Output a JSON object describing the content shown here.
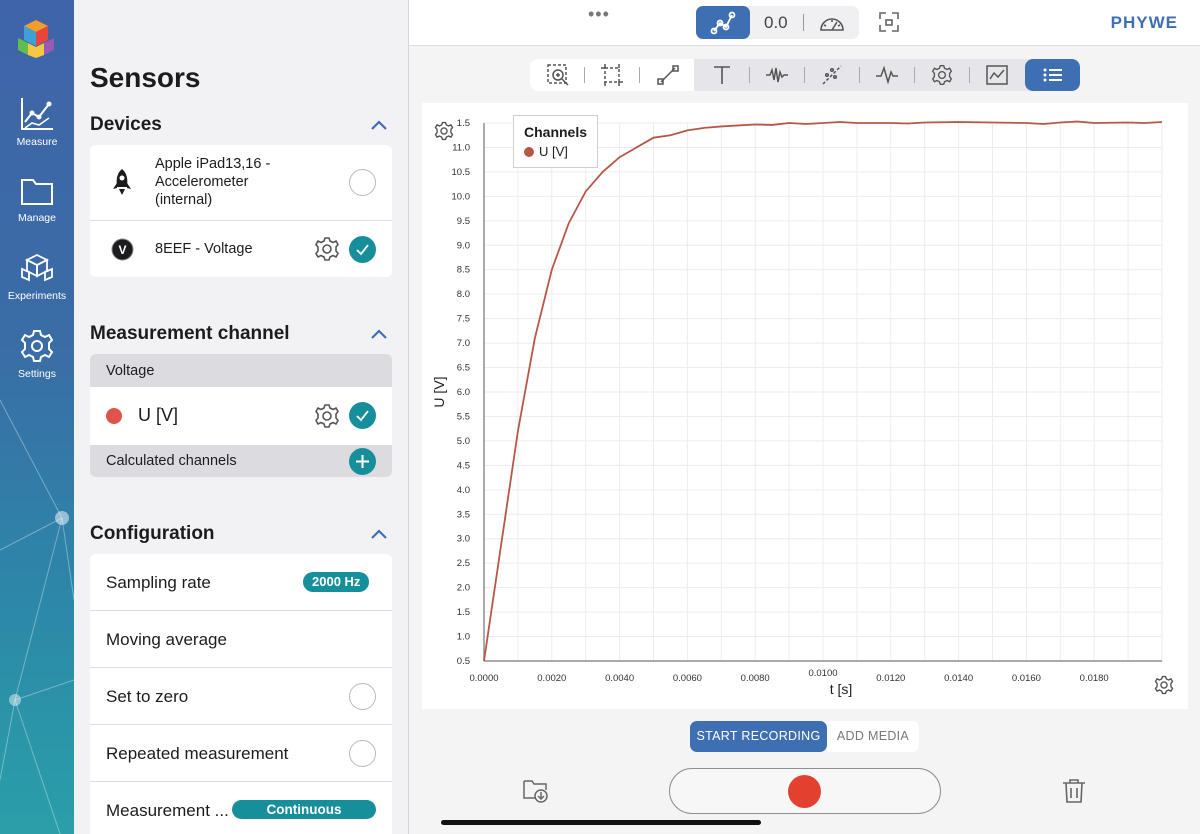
{
  "app": {
    "brand": "PHYWE",
    "more_dots": "•••"
  },
  "rail": {
    "items": [
      {
        "label": "Measure",
        "icon": "chart-line-icon"
      },
      {
        "label": "Manage",
        "icon": "folder-icon"
      },
      {
        "label": "Experiments",
        "icon": "experiments-icon"
      },
      {
        "label": "Settings",
        "icon": "gear-icon"
      }
    ]
  },
  "panel": {
    "title": "Sensors",
    "devices": {
      "heading": "Devices",
      "items": [
        {
          "name": "Apple iPad13,16 -\nAccelerometer\n(internal)",
          "icon": "rocket-icon",
          "selected": false
        },
        {
          "name": "8EEF - Voltage",
          "icon": "voltage-v-icon",
          "selected": true
        }
      ]
    },
    "channel": {
      "heading": "Measurement channel",
      "group": "Voltage",
      "item": {
        "label": "U [V]",
        "color": "#e0524a",
        "selected": true
      },
      "calculated": "Calculated channels"
    },
    "config": {
      "heading": "Configuration",
      "sampling_label": "Sampling rate",
      "sampling_value": "2000 Hz",
      "moving_avg": "Moving average",
      "set_zero": "Set to zero",
      "repeated": "Repeated measurement",
      "mode_label": "Measurement ...",
      "mode_value": "Continuous"
    }
  },
  "topbar": {
    "value": "0.0"
  },
  "bottom": {
    "start": "START RECORDING",
    "media": "ADD MEDIA"
  },
  "colors": {
    "accent": "#3f6fb3",
    "teal": "#178f9a",
    "curve": "#b85748"
  },
  "chart_data": {
    "type": "line",
    "xlabel": "t [s]",
    "ylabel": "U [V]",
    "xlim": [
      0,
      0.02
    ],
    "ylim": [
      0.5,
      11.5
    ],
    "x_ticks": [
      "0.0000",
      "0.0020",
      "0.0040",
      "0.0060",
      "0.0080",
      "0.0100",
      "0.0120",
      "0.0140",
      "0.0160",
      "0.0180"
    ],
    "y_ticks": [
      "0.5",
      "1.0",
      "1.5",
      "2.0",
      "2.5",
      "3.0",
      "3.5",
      "4.0",
      "4.5",
      "5.0",
      "5.5",
      "6.0",
      "6.5",
      "7.0",
      "7.5",
      "8.0",
      "8.5",
      "9.0",
      "9.5",
      "10.0",
      "10.5",
      "11.0",
      "1.5"
    ],
    "legend": {
      "title": "Channels",
      "position": "top-left"
    },
    "series": [
      {
        "name": "U [V]",
        "x": [
          0,
          0.001,
          0.0015,
          0.002,
          0.0025,
          0.003,
          0.0035,
          0.004,
          0.005,
          0.0055,
          0.006,
          0.0065,
          0.007,
          0.0075,
          0.008,
          0.0085,
          0.009,
          0.0095,
          0.01,
          0.0105,
          0.011,
          0.012,
          0.0125,
          0.013,
          0.014,
          0.015,
          0.016,
          0.0165,
          0.017,
          0.0175,
          0.018,
          0.019,
          0.0195,
          0.02
        ],
        "y": [
          0.5,
          5.2,
          7.1,
          8.5,
          9.45,
          10.1,
          10.5,
          10.8,
          11.2,
          11.25,
          11.35,
          11.4,
          11.43,
          11.45,
          11.47,
          11.46,
          11.5,
          11.48,
          11.5,
          11.52,
          11.5,
          11.5,
          11.49,
          11.51,
          11.52,
          11.51,
          11.5,
          11.48,
          11.51,
          11.53,
          11.5,
          11.51,
          11.5,
          11.52
        ]
      }
    ]
  }
}
